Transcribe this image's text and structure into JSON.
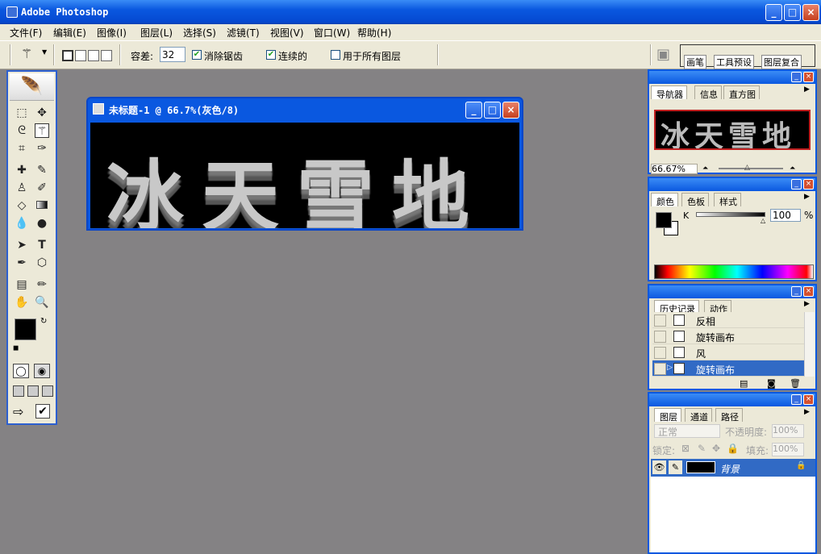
{
  "app": {
    "title": "Adobe Photoshop"
  },
  "menu": [
    "文件(F)",
    "编辑(E)",
    "图像(I)",
    "图层(L)",
    "选择(S)",
    "滤镜(T)",
    "视图(V)",
    "窗口(W)",
    "帮助(H)"
  ],
  "options": {
    "tolerance_label": "容差:",
    "tolerance_value": "32",
    "anti_alias": "消除锯齿",
    "contiguous": "连续的",
    "all_layers": "用于所有图层"
  },
  "palette_well": [
    "画笔",
    "工具预设",
    "图层复合"
  ],
  "document": {
    "title": "未标题-1 @ 66.7%(灰色/8)",
    "canvas_text": "冰天雪地"
  },
  "navigator": {
    "tabs": [
      "导航器",
      "信息",
      "直方图"
    ],
    "thumb_text": "冰天雪地",
    "zoom": "66.67%"
  },
  "color": {
    "tabs": [
      "颜色",
      "色板",
      "样式"
    ],
    "channel": "K",
    "value": "100",
    "unit": "%"
  },
  "history": {
    "tabs": [
      "历史记录",
      "动作"
    ],
    "items": [
      "反相",
      "旋转画布",
      "风",
      "旋转画布"
    ],
    "selected_index": 3
  },
  "layers": {
    "tabs": [
      "图层",
      "通道",
      "路径"
    ],
    "blend_mode": "正常",
    "opacity_label": "不透明度:",
    "opacity_value": "100%",
    "lock_label": "锁定:",
    "fill_label": "填充:",
    "fill_value": "100%",
    "layer_name": "背景"
  },
  "colors": {
    "titlebar": "#0a58e0",
    "face": "#ece9d8",
    "workspace": "#848284",
    "selection": "#316ac5"
  }
}
